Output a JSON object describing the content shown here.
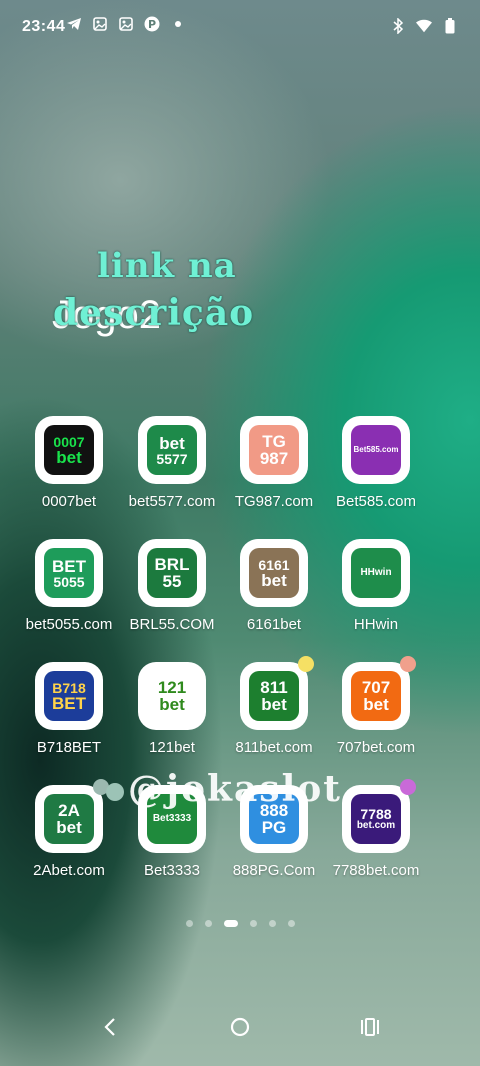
{
  "status": {
    "time": "23:44",
    "left_icons": [
      "telegram-icon",
      "photo-icon",
      "photo-icon",
      "pinterest-icon",
      "more-dot-icon"
    ],
    "right_icons": [
      "bluetooth-icon",
      "wifi-icon",
      "battery-icon"
    ]
  },
  "overlay": {
    "promo_line1": "link na",
    "promo_line2": "descrição",
    "watermark": "@jokaslot"
  },
  "folder": {
    "title": "Jogo2"
  },
  "apps": [
    {
      "label": "0007bet",
      "logo": [
        "0007",
        "bet"
      ],
      "logo_bg": "#111111",
      "logo_fg": "#19e24b"
    },
    {
      "label": "bet5577.com",
      "logo": [
        "bet",
        "5577"
      ],
      "logo_bg": "#1e8a4a",
      "logo_fg": "#ffffff"
    },
    {
      "label": "TG987.com",
      "logo": [
        "TG",
        "987"
      ],
      "logo_bg": "#f19a86",
      "logo_fg": "#ffffff"
    },
    {
      "label": "Bet585.com",
      "logo": [
        "Bet585.com"
      ],
      "logo_bg": "#8a2fb2",
      "logo_fg": "#ffffff"
    },
    {
      "label": "bet5055.com",
      "logo": [
        "BET",
        "5055"
      ],
      "logo_bg": "#1e9c5a",
      "logo_fg": "#ffffff"
    },
    {
      "label": "BRL55.COM",
      "logo": [
        "BRL",
        "55"
      ],
      "logo_bg": "#1c7a3e",
      "logo_fg": "#ffffff"
    },
    {
      "label": "6161bet",
      "logo": [
        "6161",
        "bet"
      ],
      "logo_bg": "#8a7356",
      "logo_fg": "#ffffff"
    },
    {
      "label": "HHwin",
      "logo": [
        "HHwin"
      ],
      "logo_bg": "#1e8d4b",
      "logo_fg": "#ffffff"
    },
    {
      "label": "B718BET",
      "logo": [
        "B718",
        "BET"
      ],
      "logo_bg": "#1c3d9a",
      "logo_fg": "#ffd34a"
    },
    {
      "label": "121bet",
      "logo": [
        "121",
        "bet"
      ],
      "logo_bg": "#ffffff",
      "logo_fg": "#2f8a1d"
    },
    {
      "label": "811bet.com",
      "logo": [
        "811",
        "bet"
      ],
      "logo_bg": "#1d7f2f",
      "logo_fg": "#ffffff",
      "badge": "#f5e064"
    },
    {
      "label": "707bet.com",
      "logo": [
        "707",
        "bet"
      ],
      "logo_bg": "#f26a12",
      "logo_fg": "#ffffff",
      "badge": "#f0a08c"
    },
    {
      "label": "2Abet.com",
      "logo": [
        "2A",
        "bet"
      ],
      "logo_bg": "#1f7a44",
      "logo_fg": "#ffffff",
      "badge": "#9bb9b0"
    },
    {
      "label": "Bet3333",
      "logo": [
        "Bet3333"
      ],
      "logo_bg": "#1f8a3c",
      "logo_fg": "#ffffff"
    },
    {
      "label": "888PG.Com",
      "logo": [
        "888",
        "PG"
      ],
      "logo_bg": "#2f8fe0",
      "logo_fg": "#ffffff"
    },
    {
      "label": "7788bet.com",
      "logo": [
        "7788",
        "bet.com"
      ],
      "logo_bg": "#3a1a7a",
      "logo_fg": "#ffffff",
      "badge": "#c96ad8"
    }
  ],
  "pager": {
    "pages": 6,
    "active": 3
  },
  "nav": [
    "back-icon",
    "home-icon",
    "recents-icon"
  ]
}
